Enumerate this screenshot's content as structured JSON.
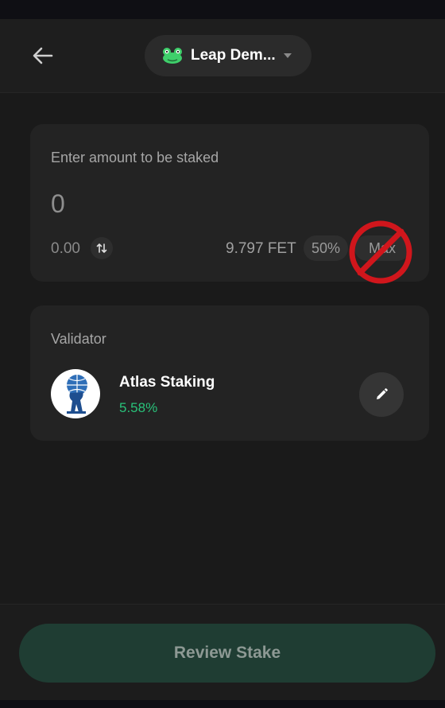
{
  "header": {
    "wallet_name": "Leap Dem...",
    "back_icon": "arrow-left-icon",
    "wallet_icon": "frog-icon",
    "caret_icon": "chevron-down-icon"
  },
  "amount_card": {
    "label": "Enter amount to be staked",
    "amount_value": "0",
    "fiat_value": "0.00",
    "swap_icon": "swap-vertical-icon",
    "balance": "9.797 FET",
    "half_label": "50%",
    "max_label": "Max"
  },
  "validator_card": {
    "label": "Validator",
    "name": "Atlas Staking",
    "apr": "5.58%",
    "logo_icon": "atlas-globe-icon",
    "edit_icon": "pencil-icon"
  },
  "footer": {
    "review_label": "Review Stake"
  },
  "colors": {
    "background": "#1b1b1b",
    "card": "#232323",
    "accent_green": "#29c27a",
    "button_disabled": "#1f3d33",
    "overlay_red": "#d0161c"
  }
}
